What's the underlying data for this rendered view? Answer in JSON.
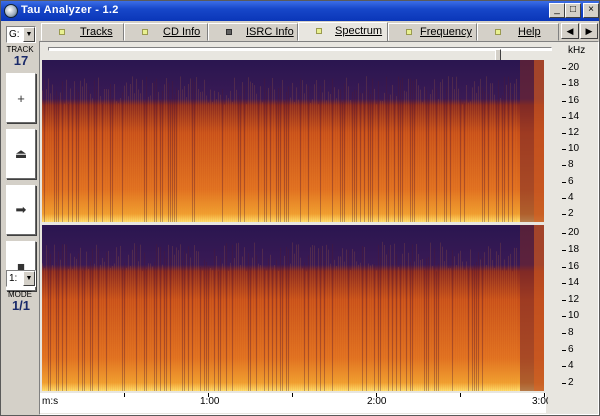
{
  "window": {
    "title": "Tau Analyzer - 1.2"
  },
  "titlebar_buttons": {
    "minimize": "_",
    "maximize": "□",
    "close": "×"
  },
  "left_panel": {
    "drive_combo": "G:",
    "track_label": "TRACK",
    "track_number": "17",
    "mode_combo": "1:",
    "mode_label": "MODE",
    "mode_value": "1/1",
    "buttons": {
      "next_icon": "+",
      "eject_icon": "⏏",
      "play_icon": "➡",
      "stop_icon": "■"
    }
  },
  "tabs": [
    {
      "label": "Tracks",
      "led": "on"
    },
    {
      "label": "CD Info",
      "led": "on"
    },
    {
      "label": "ISRC Info",
      "led": "off"
    },
    {
      "label": "Spectrum",
      "led": "on",
      "active": true
    },
    {
      "label": "Frequency",
      "led": "on"
    },
    {
      "label": "Help",
      "led": "on"
    }
  ],
  "scroll_arrows": {
    "left": "◀",
    "right": "▶"
  },
  "spectrum": {
    "unit": "kHz",
    "y_ticks_top": [
      "20",
      "18",
      "16",
      "14",
      "12",
      "10",
      "8",
      "6",
      "4",
      "2"
    ],
    "y_ticks_bottom": [
      "20",
      "18",
      "16",
      "14",
      "12",
      "10",
      "8",
      "6",
      "4",
      "2"
    ],
    "x_axis_unit": "m:s",
    "x_ticks": [
      "1:00",
      "2:00",
      "3:00"
    ],
    "slider_position": 0.9,
    "colors": {
      "bg": "#2a1650",
      "mid": "#c8501a",
      "hot": "#f0a030",
      "peak": "#ffe070"
    }
  }
}
